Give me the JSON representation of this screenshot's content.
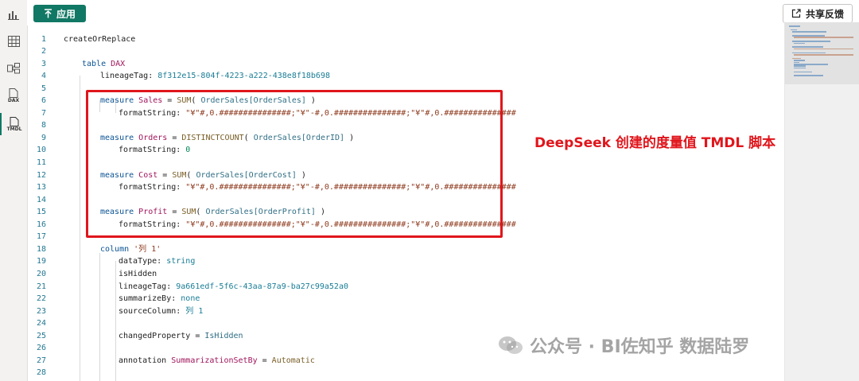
{
  "toolbar": {
    "apply_label": "应用",
    "share_label": "共享反馈",
    "apply_icon": "arrow-up-icon",
    "share_icon": "share-out-icon"
  },
  "rail": {
    "items": [
      {
        "name": "report-view",
        "icon": "bar-chart-icon"
      },
      {
        "name": "table-view",
        "icon": "table-grid-icon"
      },
      {
        "name": "model-view",
        "icon": "model-icon"
      },
      {
        "name": "dax-query-view",
        "icon": "dax-file-icon",
        "tag": "DAX"
      },
      {
        "name": "tmdl-view",
        "icon": "tmdl-file-icon",
        "tag": "TMDL",
        "active": true
      }
    ]
  },
  "annotation": "DeepSeek 创建的度量值 TMDL 脚本",
  "watermark": "公众号 · BI佐知乎 数据陆罗",
  "colors": {
    "accent": "#117865",
    "highlight": "#e0161c"
  },
  "code": [
    {
      "n": "1",
      "indent": 0,
      "tokens": [
        [
          "plain",
          "createOrReplace"
        ]
      ]
    },
    {
      "n": "2",
      "indent": 0,
      "tokens": []
    },
    {
      "n": "3",
      "indent": 1,
      "tokens": [
        [
          "kw",
          "table "
        ],
        [
          "id",
          "DAX"
        ]
      ]
    },
    {
      "n": "4",
      "indent": 2,
      "tokens": [
        [
          "plain",
          "lineageTag: "
        ],
        [
          "guid",
          "8f312e15-804f-4223-a222-438e8f18b698"
        ]
      ]
    },
    {
      "n": "5",
      "indent": 0,
      "tokens": []
    },
    {
      "n": "6",
      "indent": 2,
      "tokens": [
        [
          "kw",
          "measure "
        ],
        [
          "id",
          "Sales"
        ],
        [
          "plain",
          " = "
        ],
        [
          "fn",
          "SUM"
        ],
        [
          "plain",
          "( "
        ],
        [
          "arg",
          "OrderSales[OrderSales]"
        ],
        [
          "plain",
          " )"
        ]
      ]
    },
    {
      "n": "7",
      "indent": 3,
      "tokens": [
        [
          "plain",
          "formatString: "
        ],
        [
          "str",
          "\"¥\"#,0.###############;\"¥\"-#,0.###############;\"¥\"#,0.###############"
        ]
      ]
    },
    {
      "n": "8",
      "indent": 0,
      "tokens": []
    },
    {
      "n": "9",
      "indent": 2,
      "tokens": [
        [
          "kw",
          "measure "
        ],
        [
          "id",
          "Orders"
        ],
        [
          "plain",
          " = "
        ],
        [
          "fn",
          "DISTINCTCOUNT"
        ],
        [
          "plain",
          "( "
        ],
        [
          "arg",
          "OrderSales[OrderID]"
        ],
        [
          "plain",
          " )"
        ]
      ]
    },
    {
      "n": "10",
      "indent": 3,
      "tokens": [
        [
          "plain",
          "formatString: "
        ],
        [
          "num",
          "0"
        ]
      ]
    },
    {
      "n": "11",
      "indent": 0,
      "tokens": []
    },
    {
      "n": "12",
      "indent": 2,
      "tokens": [
        [
          "kw",
          "measure "
        ],
        [
          "id",
          "Cost"
        ],
        [
          "plain",
          " = "
        ],
        [
          "fn",
          "SUM"
        ],
        [
          "plain",
          "( "
        ],
        [
          "arg",
          "OrderSales[OrderCost]"
        ],
        [
          "plain",
          " )"
        ]
      ]
    },
    {
      "n": "13",
      "indent": 3,
      "tokens": [
        [
          "plain",
          "formatString: "
        ],
        [
          "str",
          "\"¥\"#,0.###############;\"¥\"-#,0.###############;\"¥\"#,0.###############"
        ]
      ]
    },
    {
      "n": "14",
      "indent": 0,
      "tokens": []
    },
    {
      "n": "15",
      "indent": 2,
      "tokens": [
        [
          "kw",
          "measure "
        ],
        [
          "id",
          "Profit"
        ],
        [
          "plain",
          " = "
        ],
        [
          "fn",
          "SUM"
        ],
        [
          "plain",
          "( "
        ],
        [
          "arg",
          "OrderSales[OrderProfit]"
        ],
        [
          "plain",
          " )"
        ]
      ]
    },
    {
      "n": "16",
      "indent": 3,
      "tokens": [
        [
          "plain",
          "formatString: "
        ],
        [
          "str",
          "\"¥\"#,0.###############;\"¥\"-#,0.###############;\"¥\"#,0.###############"
        ]
      ]
    },
    {
      "n": "17",
      "indent": 0,
      "tokens": []
    },
    {
      "n": "18",
      "indent": 2,
      "tokens": [
        [
          "kw",
          "column "
        ],
        [
          "str",
          "'列 1'"
        ]
      ]
    },
    {
      "n": "19",
      "indent": 3,
      "tokens": [
        [
          "plain",
          "dataType: "
        ],
        [
          "guid",
          "string"
        ]
      ]
    },
    {
      "n": "20",
      "indent": 3,
      "tokens": [
        [
          "plain",
          "isHidden"
        ]
      ]
    },
    {
      "n": "21",
      "indent": 3,
      "tokens": [
        [
          "plain",
          "lineageTag: "
        ],
        [
          "guid",
          "9a661edf-5f6c-43aa-87a9-ba27c99a52a0"
        ]
      ]
    },
    {
      "n": "22",
      "indent": 3,
      "tokens": [
        [
          "plain",
          "summarizeBy: "
        ],
        [
          "guid",
          "none"
        ]
      ]
    },
    {
      "n": "23",
      "indent": 3,
      "tokens": [
        [
          "plain",
          "sourceColumn: "
        ],
        [
          "guid",
          "列 1"
        ]
      ]
    },
    {
      "n": "24",
      "indent": 0,
      "tokens": []
    },
    {
      "n": "25",
      "indent": 3,
      "tokens": [
        [
          "plain",
          "changedProperty = "
        ],
        [
          "arg",
          "IsHidden"
        ]
      ]
    },
    {
      "n": "26",
      "indent": 0,
      "tokens": []
    },
    {
      "n": "27",
      "indent": 3,
      "tokens": [
        [
          "plain",
          "annotation "
        ],
        [
          "id",
          "SummarizationSetBy"
        ],
        [
          "plain",
          " = "
        ],
        [
          "fn",
          "Automatic"
        ]
      ]
    },
    {
      "n": "28",
      "indent": 0,
      "tokens": []
    }
  ]
}
